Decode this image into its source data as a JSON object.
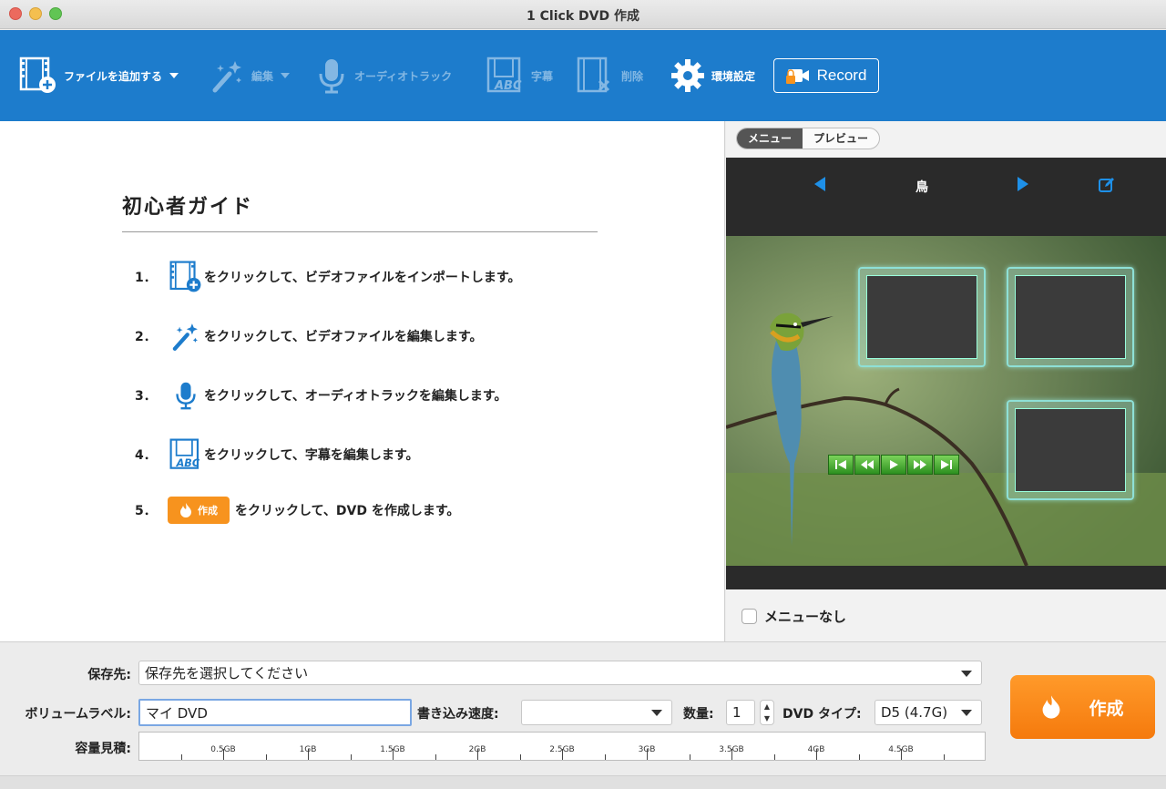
{
  "window": {
    "title": "1 Click DVD 作成"
  },
  "toolbar": {
    "add_file": "ファイルを追加する",
    "edit": "編集",
    "audio_track": "オーディオトラック",
    "subtitle": "字幕",
    "delete": "削除",
    "preferences": "環境設定",
    "record": "Record"
  },
  "guide": {
    "title": "初心者ガイド",
    "steps": [
      {
        "num": "1．",
        "text": "をクリックして、ビデオファイルをインポートします。",
        "icon": "add-video-icon"
      },
      {
        "num": "2．",
        "text": "をクリックして、ビデオファイルを編集します。",
        "icon": "magic-wand-icon"
      },
      {
        "num": "3．",
        "text": "をクリックして、オーディオトラックを編集します。",
        "icon": "microphone-icon"
      },
      {
        "num": "4．",
        "text": "をクリックして、字幕を編集します。",
        "icon": "subtitle-abc-icon"
      },
      {
        "num": "5．",
        "text": "をクリックして、DVD を作成します。",
        "icon": "flame-icon",
        "button_label": "作成"
      }
    ]
  },
  "preview": {
    "tabs": [
      "メニュー",
      "プレビュー"
    ],
    "active_tab": "メニュー",
    "menu_name": "鳥",
    "no_menu_label": "メニューなし",
    "no_menu_checked": false
  },
  "output": {
    "save_to_label": "保存先:",
    "save_to_value": "保存先を選択してください",
    "volume_label_label": "ボリュームラベル:",
    "volume_label_value": "マイ DVD",
    "write_speed_label": "書き込み速度:",
    "write_speed_value": "",
    "copies_label": "数量:",
    "copies_value": "1",
    "dvd_type_label": "DVD タイプ:",
    "dvd_type_value": "D5 (4.7G)",
    "capacity_label": "容量見積:",
    "capacity_ticks": [
      "0.5GB",
      "1GB",
      "1.5GB",
      "2GB",
      "2.5GB",
      "3GB",
      "3.5GB",
      "4GB",
      "4.5GB"
    ],
    "create_label": "作成"
  },
  "colors": {
    "toolbar_blue": "#1d7ccc",
    "accent_orange": "#f7931e",
    "nav_blue": "#1e90e8"
  }
}
